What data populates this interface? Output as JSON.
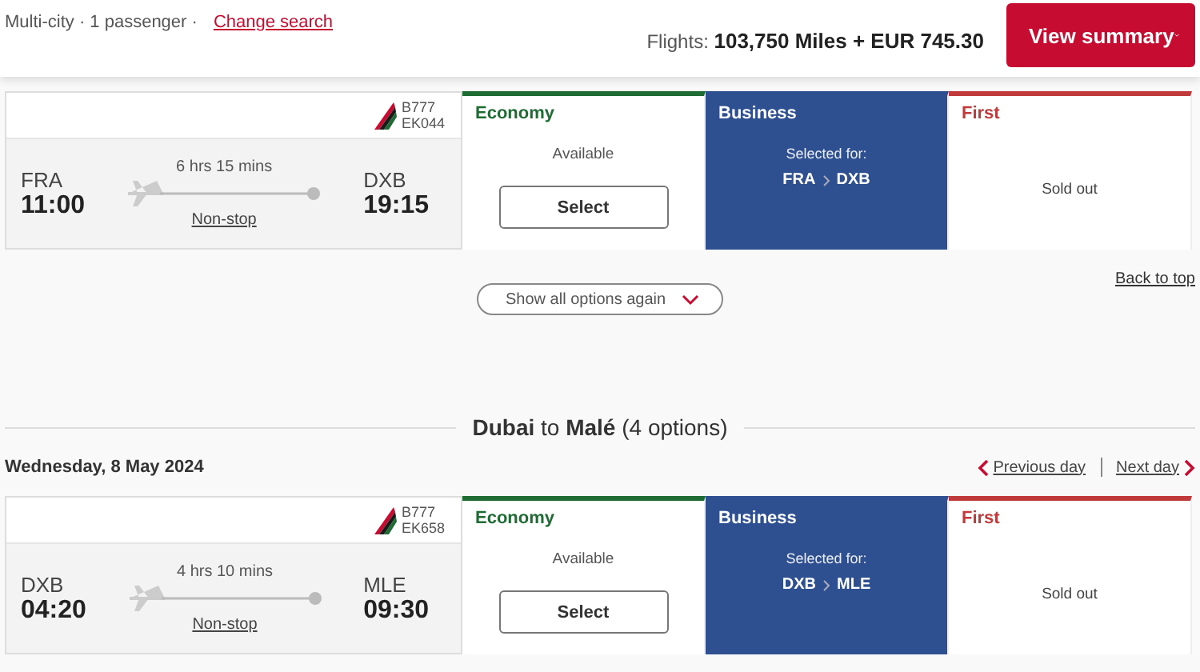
{
  "header": {
    "trip_summary": "Multi-city · 1 passenger ·",
    "change_link": "Change search",
    "total_label": "Flights:",
    "total_value": "103,750 Miles + EUR 745.30",
    "summary_button": "View summary"
  },
  "segments": [
    {
      "flight": {
        "aircraft": "B777",
        "flight_number": "EK044",
        "origin": "FRA",
        "departure": "11:00",
        "duration": "6 hrs 15 mins",
        "destination": "DXB",
        "arrival": "19:15",
        "stops": "Non-stop"
      },
      "fares": [
        {
          "cabin": "Economy",
          "color": "#1e6b34",
          "selected": false,
          "kind": "available",
          "status": "Available",
          "button": "Select"
        },
        {
          "cabin": "Business",
          "color": "#2e5090",
          "selected": true,
          "kind": "selected",
          "status": "Selected for:",
          "route_from": "FRA",
          "route_to": "DXB"
        },
        {
          "cabin": "First",
          "color": "#c0393b",
          "selected": false,
          "kind": "soldout",
          "status": "Sold out"
        }
      ],
      "show_all": "Show all options again",
      "back_to_top": "Back to top"
    },
    {
      "heading": "**Dubai** to **Malé** (4 options)",
      "date": "Wednesday, 8 May 2024",
      "previous_day": "Previous day",
      "next_day": "Next day",
      "flight": {
        "aircraft": "B777",
        "flight_number": "EK658",
        "origin": "DXB",
        "departure": "04:20",
        "duration": "4 hrs 10 mins",
        "destination": "MLE",
        "arrival": "09:30",
        "stops": "Non-stop"
      },
      "fares": [
        {
          "cabin": "Economy",
          "color": "#1e6b34",
          "selected": false,
          "kind": "available",
          "status": "Available",
          "button": "Select"
        },
        {
          "cabin": "Business",
          "color": "#2e5090",
          "selected": true,
          "kind": "selected",
          "status": "Selected for:",
          "route_from": "DXB",
          "route_to": "MLE"
        },
        {
          "cabin": "First",
          "color": "#c0393b",
          "selected": false,
          "kind": "soldout",
          "status": "Sold out"
        }
      ]
    }
  ]
}
